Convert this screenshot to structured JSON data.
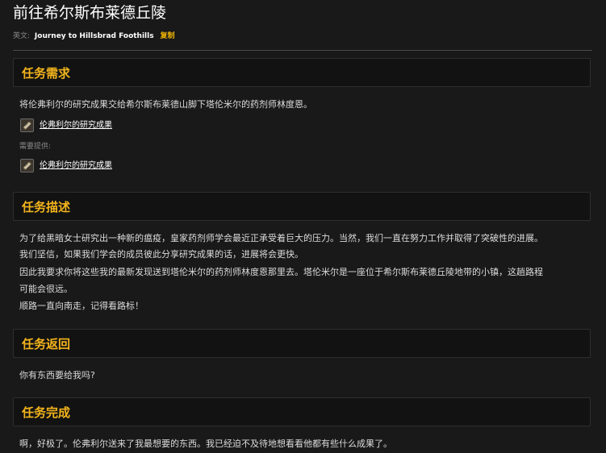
{
  "quest": {
    "title": "前往希尔斯布莱德丘陵",
    "english_label": "英文:",
    "english_name": "Journey to Hillsbrad Foothills",
    "copy_label": "复制"
  },
  "requirements": {
    "heading": "任务需求",
    "objective": "将伦弗利尔的研究成果交给希尔斯布莱德山脚下塔伦米尔的药剂师林度恩。",
    "required_item": "伦弗利尔的研究成果",
    "provided_label": "需要提供:",
    "provided_item": "伦弗利尔的研究成果"
  },
  "description": {
    "heading": "任务描述",
    "lines": [
      "为了给黑暗女士研究出一种新的瘟疫，皇家药剂师学会最近正承受着巨大的压力。当然，我们一直在努力工作并取得了突破性的进展。",
      "我们坚信，如果我们学会的成员彼此分享研究成果的话，进展将会更快。",
      "因此我要求你将这些我的最新发现送到塔伦米尔的药剂师林度恩那里去。塔伦米尔是一座位于希尔斯布莱德丘陵地带的小镇，这趟路程",
      "可能会很远。",
      "顺路一直向南走，记得看路标！"
    ]
  },
  "progress": {
    "heading": "任务返回",
    "text": "你有东西要给我吗?"
  },
  "completion": {
    "heading": "任务完成",
    "text": "啊，好极了。伦弗利尔送来了我最想要的东西。我已经迫不及待地想看看他都有些什么成果了。"
  },
  "colors": {
    "background": "#191919",
    "heading_gold": "#f3b41d",
    "copy_link": "#f0b400",
    "text": "#dcdcdc",
    "muted": "#8a8a8a"
  },
  "icons": {
    "item_icon": "scroll-icon"
  }
}
